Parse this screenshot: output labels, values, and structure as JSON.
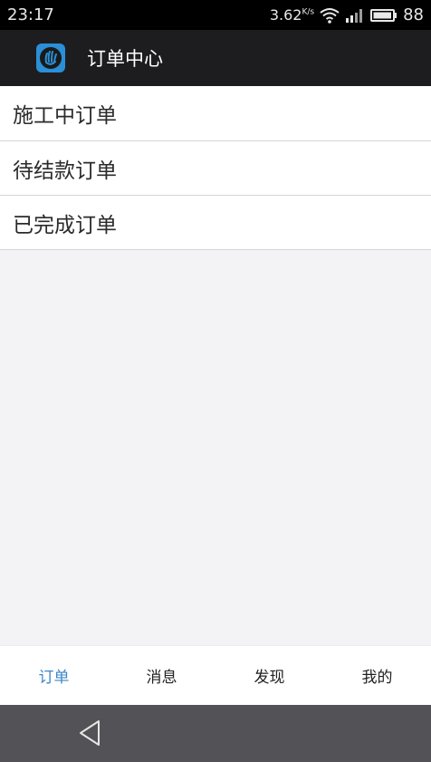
{
  "status_bar": {
    "time": "23:17",
    "speed": "3.62",
    "speed_unit": "K/s",
    "battery_level": "88"
  },
  "app_bar": {
    "logo_icon": "hand-logo-icon",
    "title": "订单中心"
  },
  "orders": [
    {
      "label": "施工中订单"
    },
    {
      "label": "待结款订单"
    },
    {
      "label": "已完成订单"
    }
  ],
  "bottom_nav": {
    "tabs": [
      {
        "label": "订单",
        "active": true
      },
      {
        "label": "消息",
        "active": false
      },
      {
        "label": "发现",
        "active": false
      },
      {
        "label": "我的",
        "active": false
      }
    ]
  },
  "colors": {
    "accent": "#3d86c8",
    "app_bar_bg": "#1d1d1f",
    "page_bg": "#f3f2f5"
  }
}
